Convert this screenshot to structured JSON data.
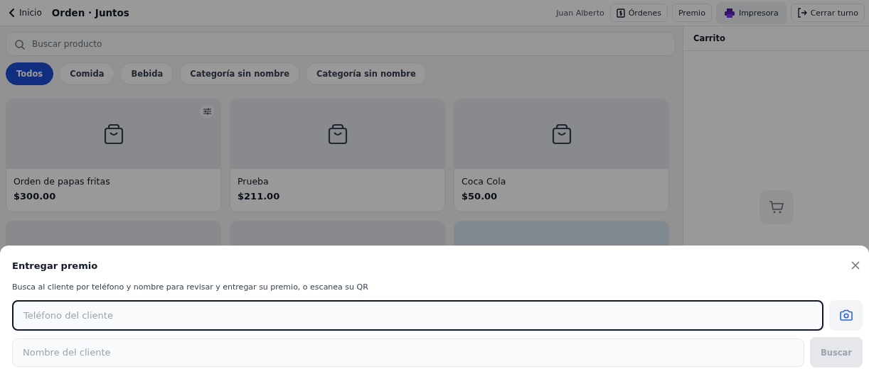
{
  "header": {
    "back_label": "Inicio",
    "title": "Orden · Juntos",
    "user": "Juan Alberto",
    "actions": [
      {
        "label": "Órdenes",
        "kind": "receipt",
        "selected": false
      },
      {
        "label": "Premio",
        "selected": false
      },
      {
        "label": "Impresora",
        "kind": "printer",
        "selected": true
      },
      {
        "label": "Cerrar turno",
        "kind": "logout",
        "selected": false
      }
    ]
  },
  "search": {
    "placeholder": "Buscar producto"
  },
  "categories": [
    {
      "label": "Todos",
      "selected": true
    },
    {
      "label": "Comida",
      "selected": false
    },
    {
      "label": "Bebida",
      "selected": false
    },
    {
      "label": "Categoría sin nombre",
      "selected": false
    },
    {
      "label": "Categoría sin nombre",
      "selected": false
    }
  ],
  "products": [
    {
      "kind": "card",
      "name": "Orden de papas fritas",
      "price": "$300.00",
      "options": true
    },
    {
      "kind": "card",
      "name": "Prueba",
      "price": "$211.00",
      "options": false
    },
    {
      "kind": "card",
      "name": "Coca Cola",
      "price": "$50.00",
      "options": false
    },
    {
      "kind": "partial"
    },
    {
      "kind": "partial"
    },
    {
      "kind": "partial"
    }
  ],
  "cart": {
    "title": "Carrito"
  },
  "dialog": {
    "title": "Entregar premio",
    "description": "Busca al cliente por teléfono y nombre para revisar y entregar su premio, o escanea su QR",
    "phone": {
      "placeholder": "Teléfono del cliente",
      "focused": true
    },
    "name": {
      "placeholder": "Nombre del cliente",
      "focused": false
    },
    "search_button": {
      "label": "Buscar",
      "disabled": true
    }
  }
}
